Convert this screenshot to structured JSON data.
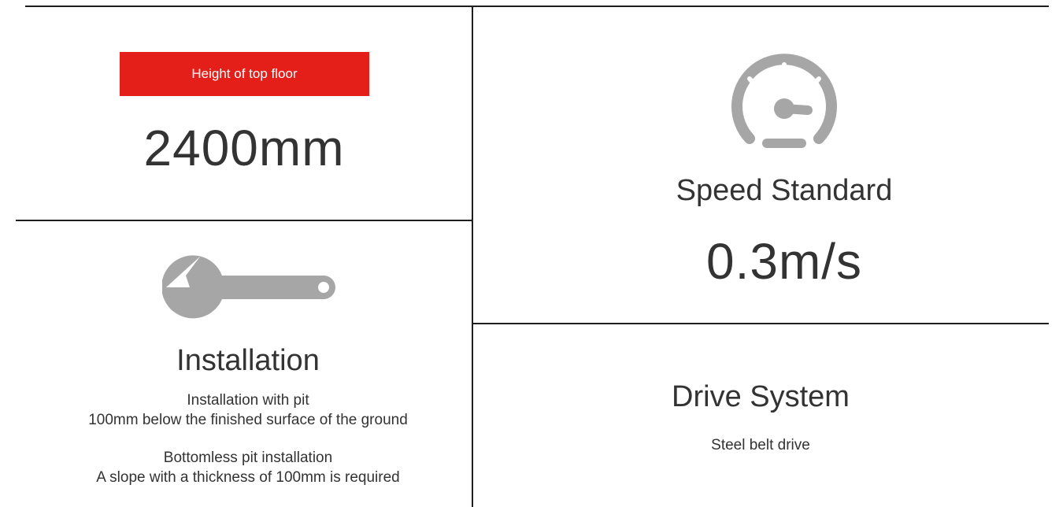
{
  "colors": {
    "accent_red": "#e41f19",
    "icon_gray": "#a6a6a6",
    "text_dark": "#333333",
    "divider": "#1e1e1e"
  },
  "top_floor": {
    "badge_label": "Height of top floor",
    "value": "2400mm"
  },
  "installation": {
    "icon": "wrench-icon",
    "title": "Installation",
    "lines_1": [
      "Installation with pit",
      "100mm below the finished surface of the ground"
    ],
    "lines_2": [
      "Bottomless pit installation",
      "A slope with a thickness of 100mm is required"
    ]
  },
  "speed": {
    "icon": "speedometer-icon",
    "title": "Speed Standard",
    "value": "0.3m/s"
  },
  "drive": {
    "title": "Drive System",
    "description": "Steel belt drive"
  }
}
